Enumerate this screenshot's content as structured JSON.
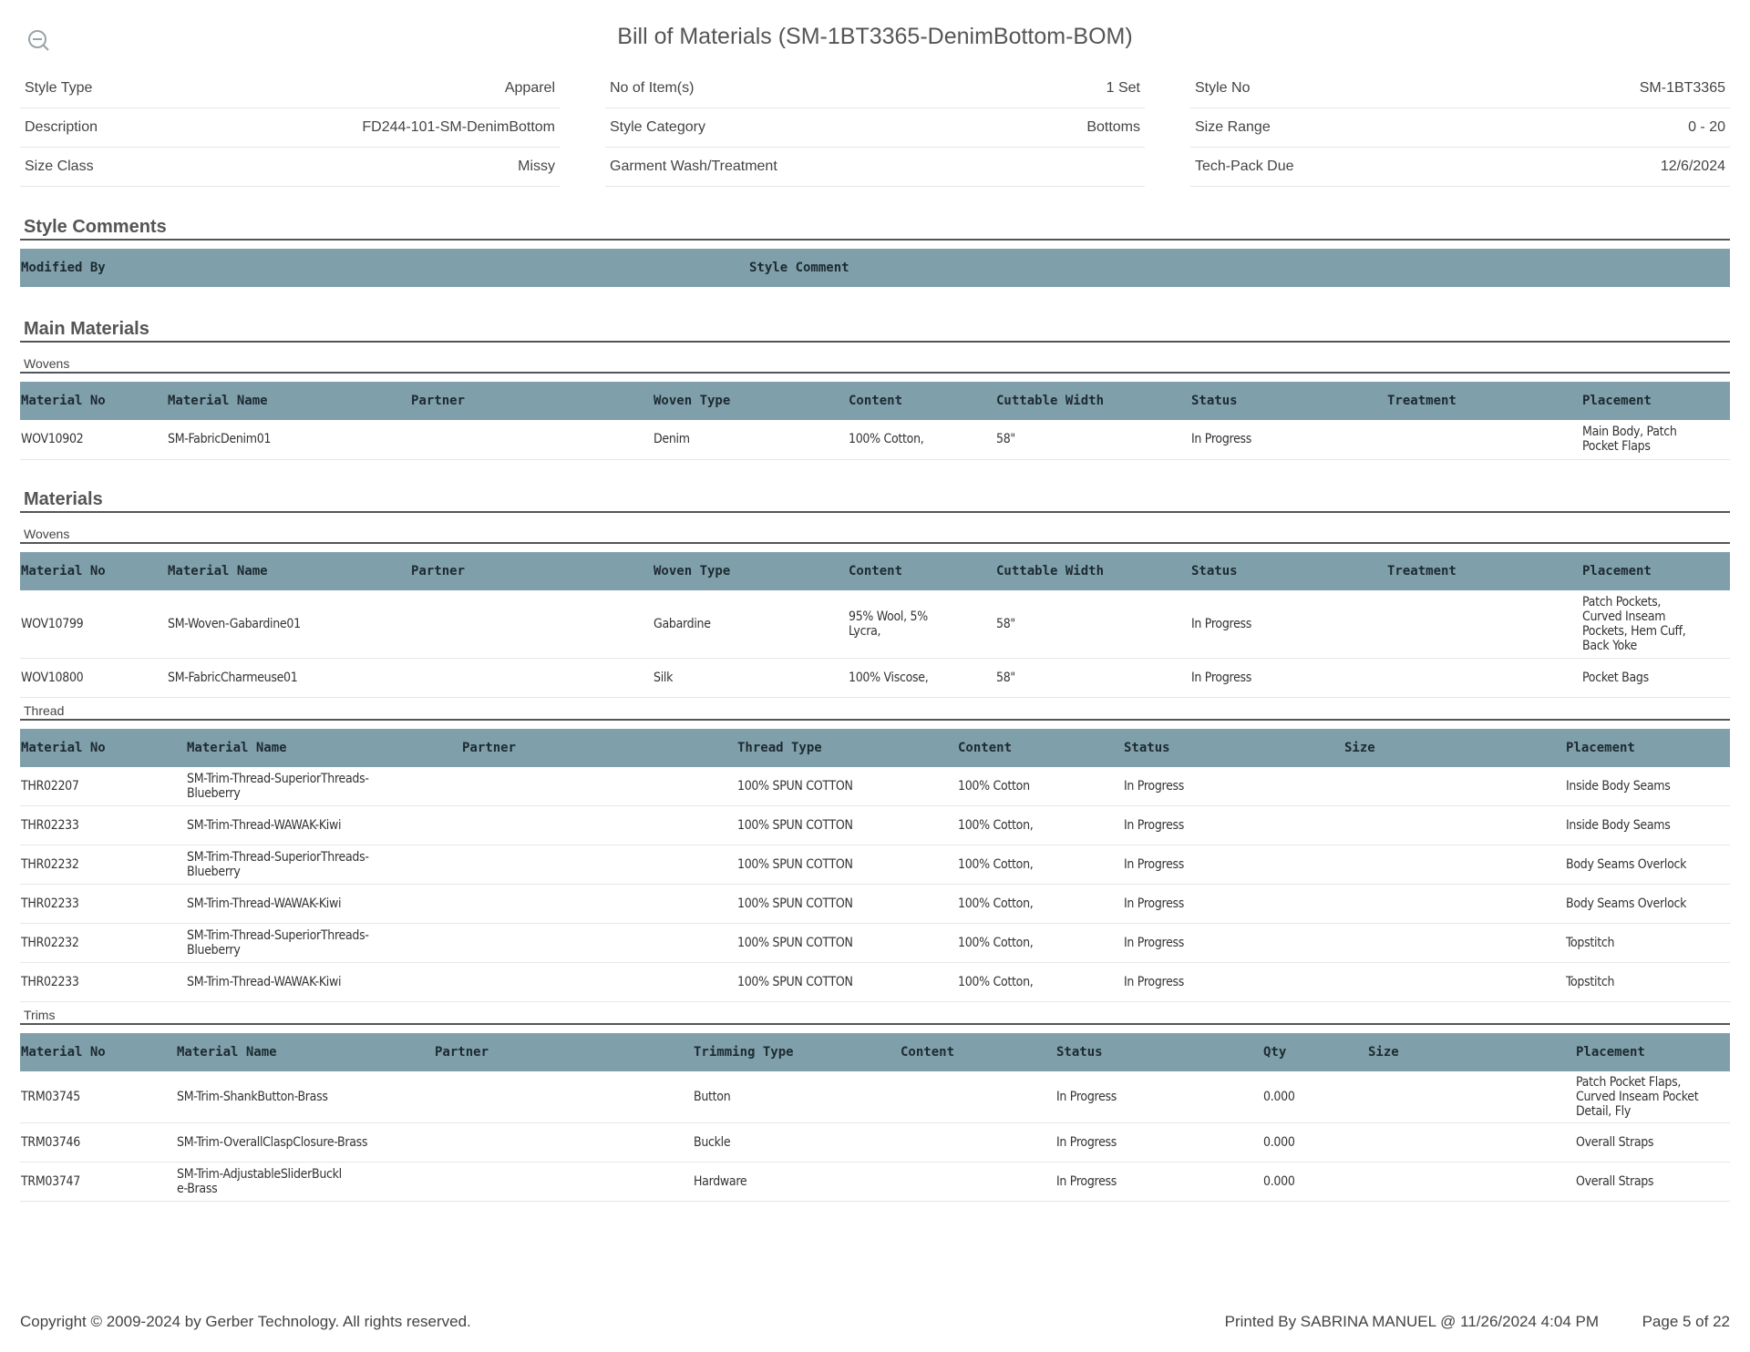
{
  "title": "Bill of Materials (SM-1BT3365-DenimBottom-BOM)",
  "summary": {
    "col1": [
      {
        "label": "Style Type",
        "value": "Apparel"
      },
      {
        "label": "Description",
        "value": "FD244-101-SM-DenimBottom"
      },
      {
        "label": "Size Class",
        "value": "Missy"
      }
    ],
    "col2": [
      {
        "label": "No of Item(s)",
        "value": "1 Set"
      },
      {
        "label": "Style Category",
        "value": "Bottoms"
      },
      {
        "label": "Garment Wash/Treatment",
        "value": ""
      }
    ],
    "col3": [
      {
        "label": "Style No",
        "value": "SM-1BT3365"
      },
      {
        "label": "Size Range",
        "value": "0 - 20"
      },
      {
        "label": "Tech-Pack Due",
        "value": "12/6/2024"
      }
    ]
  },
  "style_comments": {
    "title": "Style Comments",
    "headers": [
      "Modified By",
      "Style Comment"
    ]
  },
  "main_materials": {
    "title": "Main Materials",
    "wovens_label": "Wovens",
    "headers": [
      "Material No",
      "Material Name",
      "Partner",
      "Woven Type",
      "Content",
      "Cuttable Width",
      "Status",
      "Treatment",
      "Placement"
    ],
    "rows": [
      [
        "WOV10902",
        "SM-FabricDenim01",
        "",
        "Denim",
        "100% Cotton,",
        "58\"",
        "In Progress",
        "",
        "Main Body, Patch Pocket Flaps"
      ]
    ]
  },
  "materials": {
    "title": "Materials",
    "wovens_label": "Wovens",
    "wovens_headers": [
      "Material No",
      "Material Name",
      "Partner",
      "Woven Type",
      "Content",
      "Cuttable Width",
      "Status",
      "Treatment",
      "Placement"
    ],
    "wovens_rows": [
      [
        "WOV10799",
        "SM-Woven-Gabardine01",
        "",
        "Gabardine",
        "95% Wool, 5% Lycra,",
        "58\"",
        "In Progress",
        "",
        "Patch Pockets, Curved Inseam Pockets, Hem Cuff, Back Yoke"
      ],
      [
        "WOV10800",
        "SM-FabricCharmeuse01",
        "",
        "Silk",
        "100% Viscose,",
        "58\"",
        "In Progress",
        "",
        "Pocket Bags"
      ]
    ],
    "thread_label": "Thread",
    "thread_headers": [
      "Material No",
      "Material Name",
      "Partner",
      "Thread Type",
      "Content",
      "Status",
      "Size",
      "Placement"
    ],
    "thread_rows": [
      [
        "THR02207",
        "SM-Trim-Thread-SuperiorThreads-Blueberry",
        "",
        "100% SPUN COTTON",
        "100% Cotton",
        "In Progress",
        "",
        "Inside Body Seams"
      ],
      [
        "THR02233",
        "SM-Trim-Thread-WAWAK-Kiwi",
        "",
        "100% SPUN COTTON",
        "100% Cotton,",
        "In Progress",
        "",
        "Inside Body Seams"
      ],
      [
        "THR02232",
        "SM-Trim-Thread-SuperiorThreads-Blueberry",
        "",
        "100% SPUN COTTON",
        "100% Cotton,",
        "In Progress",
        "",
        "Body Seams Overlock"
      ],
      [
        "THR02233",
        "SM-Trim-Thread-WAWAK-Kiwi",
        "",
        "100% SPUN COTTON",
        "100% Cotton,",
        "In Progress",
        "",
        "Body Seams Overlock"
      ],
      [
        "THR02232",
        "SM-Trim-Thread-SuperiorThreads-Blueberry",
        "",
        "100% SPUN COTTON",
        "100% Cotton,",
        "In Progress",
        "",
        "Topstitch"
      ],
      [
        "THR02233",
        "SM-Trim-Thread-WAWAK-Kiwi",
        "",
        "100% SPUN COTTON",
        "100% Cotton,",
        "In Progress",
        "",
        "Topstitch"
      ]
    ],
    "trims_label": "Trims",
    "trims_headers": [
      "Material No",
      "Material Name",
      "Partner",
      "Trimming Type",
      "Content",
      "Status",
      "Qty",
      "Size",
      "Placement"
    ],
    "trims_rows": [
      [
        "TRM03745",
        "SM-Trim-ShankButton-Brass",
        "",
        "Button",
        "",
        "In Progress",
        "0.000",
        "",
        "Patch Pocket Flaps, Curved Inseam Pocket Detail, Fly"
      ],
      [
        "TRM03746",
        "SM-Trim-OverallClaspClosure-Brass",
        "",
        "Buckle",
        "",
        "In Progress",
        "0.000",
        "",
        "Overall Straps"
      ],
      [
        "TRM03747",
        "SM-Trim-AdjustableSliderBuckle-Brass",
        "",
        "Hardware",
        "",
        "In Progress",
        "0.000",
        "",
        "Overall Straps"
      ]
    ]
  },
  "footer": {
    "copyright": "Copyright © 2009-2024 by Gerber Technology. All rights reserved.",
    "printed_by": "Printed By SABRINA MANUEL @ 11/26/2024 4:04 PM",
    "page": "Page 5 of 22"
  }
}
